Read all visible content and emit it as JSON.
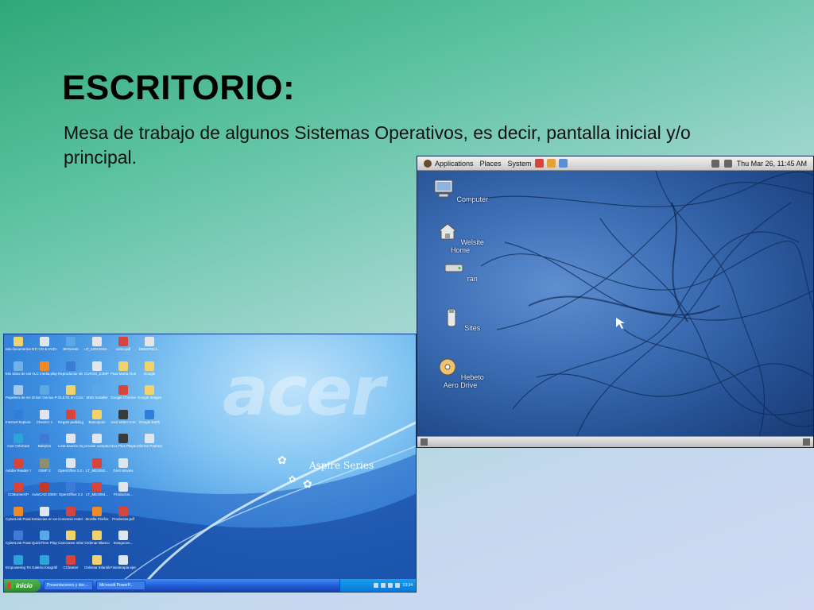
{
  "slide": {
    "title": "ESCRITORIO:",
    "body": "Mesa de trabajo de algunos Sistemas Operativos, es decir, pantalla inicial y/o principal."
  },
  "linux": {
    "panel": {
      "applications": "Applications",
      "places": "Places",
      "system": "System",
      "clock": "Thu Mar 26, 11:45 AM"
    },
    "icons": [
      {
        "label": "Computer",
        "icon": "computer-icon"
      },
      {
        "label": "Welsite Home",
        "icon": "home-folder-icon"
      },
      {
        "label": "ran",
        "icon": "drive-icon"
      },
      {
        "label": "Sites",
        "icon": "usb-drive-icon"
      },
      {
        "label": "Hebeto Aero Drive",
        "icon": "optical-drive-icon"
      }
    ]
  },
  "xp": {
    "brand": "acer",
    "series": "Aspire Series",
    "start_label": "Inicio",
    "taskbar_items": [
      "Presentaciones y doc...",
      "Microsoft PowerP..."
    ],
    "clock": "13:34",
    "icons": [
      {
        "label": "Mis documentos",
        "color": "#f2d36b"
      },
      {
        "label": "NTI CD & DVD-Maker 7",
        "color": "#dfe6ef"
      },
      {
        "label": "BitTorrent",
        "color": "#5aa9e6"
      },
      {
        "label": "uT_22012010...",
        "color": "#e5e5e5"
      },
      {
        "label": "curso.pdf",
        "color": "#d9443a"
      },
      {
        "label": "D8M4F6C4...",
        "color": "#e5e5e5"
      },
      {
        "label": "Mis sitios de red",
        "color": "#6fb1e8"
      },
      {
        "label": "VLC media player",
        "color": "#f08a24"
      },
      {
        "label": "Reproductor de Window...",
        "color": "#3d7bd6"
      },
      {
        "label": "CURSO_EJMP LTRAC.DOC",
        "color": "#dfe6ef"
      },
      {
        "label": "Para Marta Alumno ...",
        "color": "#f2d36b"
      },
      {
        "label": "Google",
        "color": "#f2d36b"
      },
      {
        "label": "Papelera de reciclaje",
        "color": "#a7c8e8"
      },
      {
        "label": "Driver Genius PE V9.0.0.1...",
        "color": "#5aa9e6"
      },
      {
        "label": "DLETE en Coco",
        "color": "#f2d36b"
      },
      {
        "label": "MSN Installer",
        "color": "#5aa9e6"
      },
      {
        "label": "Google Chrome",
        "color": "#d9443a"
      },
      {
        "label": "Google Images",
        "color": "#f2d36b"
      },
      {
        "label": "Internet Explorer",
        "color": "#2f7fd8"
      },
      {
        "label": "Checkro 1",
        "color": "#dfe6ef"
      },
      {
        "label": "Regalo pedido.jpg",
        "color": "#d9443a"
      },
      {
        "label": "Buscapolo",
        "color": "#f2d36b"
      },
      {
        "label": "Ares Video Converter",
        "color": "#3a3a3a"
      },
      {
        "label": "Google Earth",
        "color": "#2f7fd8"
      },
      {
        "label": "Acer OrbiCam",
        "color": "#2ea3d8"
      },
      {
        "label": "Babylon",
        "color": "#3d7bd6"
      },
      {
        "label": "Lista bautizo regalos.doc",
        "color": "#dfe6ef"
      },
      {
        "label": "circular cumplea...",
        "color": "#dfe6ef"
      },
      {
        "label": "Divx Plus Player",
        "color": "#3a3a3a"
      },
      {
        "label": "informe Padres(7)...",
        "color": "#dfe6ef"
      },
      {
        "label": "Adobe Reader 7.0",
        "color": "#d9443a"
      },
      {
        "label": "GIMP 2",
        "color": "#8f8f6b"
      },
      {
        "label": "OpenOffice 3.2 (es) Ins...",
        "color": "#dfe6ef"
      },
      {
        "label": "LT_ME2052...",
        "color": "#d9443a"
      },
      {
        "label": "DivX Movies",
        "color": "#dfe6ef"
      },
      {
        "label": "",
        "color": ""
      },
      {
        "label": "CDBurnerXP",
        "color": "#d9443a"
      },
      {
        "label": "AutoCAD 2008 España",
        "color": "#c0392b"
      },
      {
        "label": "OpenOffice 3.2",
        "color": "#3d7bd6"
      },
      {
        "label": "LT_ME2084...",
        "color": "#d9443a"
      },
      {
        "label": "Productos...",
        "color": "#dfe6ef"
      },
      {
        "label": "",
        "color": ""
      },
      {
        "label": "CyberLink PowerDVD",
        "color": "#f08a24"
      },
      {
        "label": "Estancias en un Hotel.xls",
        "color": "#dfe6ef"
      },
      {
        "label": "Convenio Hotel.pdf",
        "color": "#d9443a"
      },
      {
        "label": "Mozilla Firefox",
        "color": "#f08a24"
      },
      {
        "label": "Productos.pdf",
        "color": "#d9443a"
      },
      {
        "label": "",
        "color": ""
      },
      {
        "label": "CyberLink PowerProd...",
        "color": "#3d7bd6"
      },
      {
        "label": "QuickTime Player",
        "color": "#5aa9e6"
      },
      {
        "label": "Canciones Infantiles",
        "color": "#f2d36b"
      },
      {
        "label": "Ordenar Blanco",
        "color": "#f2d36b"
      },
      {
        "label": "Insegucen...",
        "color": "#dfe6ef"
      },
      {
        "label": "",
        "color": ""
      },
      {
        "label": "Empowering Technology",
        "color": "#2ea3d8"
      },
      {
        "label": "Galería fotográfica...",
        "color": "#2ea3d8"
      },
      {
        "label": "CCleaner",
        "color": "#d9443a"
      },
      {
        "label": "Ordenar Infantiles",
        "color": "#f2d36b"
      },
      {
        "label": "Fisioterapia ejercicios en...",
        "color": "#dfe6ef"
      },
      {
        "label": "",
        "color": ""
      }
    ]
  }
}
